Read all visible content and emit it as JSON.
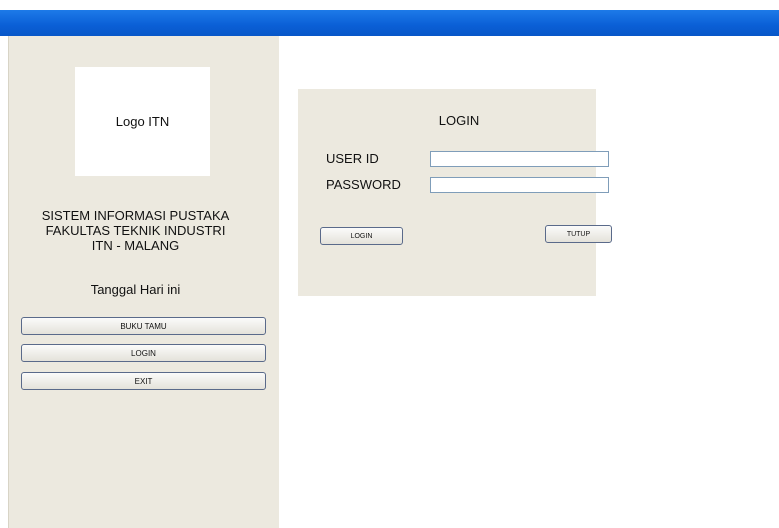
{
  "sidebar": {
    "logo_text": "Logo ITN",
    "app_title_line1": "SISTEM INFORMASI PUSTAKA",
    "app_title_line2": "FAKULTAS TEKNIK INDUSTRI",
    "app_title_line3": "ITN - MALANG",
    "date_text": "Tanggal Hari ini",
    "buttons": [
      {
        "label": "BUKU TAMU"
      },
      {
        "label": "LOGIN"
      },
      {
        "label": "EXIT"
      }
    ]
  },
  "login_panel": {
    "title": "LOGIN",
    "user_id_label": "USER ID",
    "user_id_value": "",
    "password_label": "PASSWORD",
    "password_value": "",
    "login_button": "LOGIN",
    "close_button": "TUTUP"
  },
  "colors": {
    "titlebar": "#0a5fd6",
    "panel_bg": "#ece9df"
  }
}
